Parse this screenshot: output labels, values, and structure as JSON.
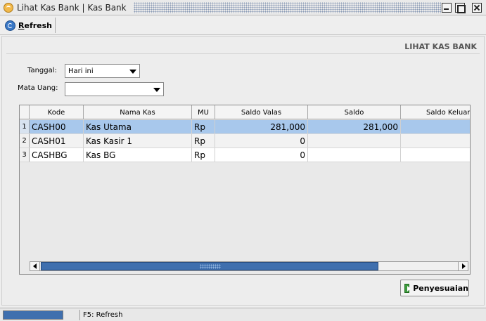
{
  "window": {
    "title": "Lihat Kas Bank | Kas Bank"
  },
  "toolbar": {
    "refresh_label_first": "R",
    "refresh_label_rest": "efresh"
  },
  "page": {
    "title": "LIHAT KAS BANK"
  },
  "form": {
    "tanggal_label": "Tanggal:",
    "tanggal_value": "Hari ini",
    "mata_uang_label": "Mata Uang:",
    "mata_uang_value": ""
  },
  "table": {
    "columns": [
      "Kode",
      "Nama Kas",
      "MU",
      "Saldo Valas",
      "Saldo",
      "Saldo Keluar"
    ],
    "rows": [
      {
        "num": "1",
        "kode": "CASH00",
        "nama": "Kas Utama",
        "mu": "Rp",
        "saldo_valas": "281,000",
        "saldo": "281,000",
        "saldo_keluar": ""
      },
      {
        "num": "2",
        "kode": "CASH01",
        "nama": "Kas Kasir 1",
        "mu": "Rp",
        "saldo_valas": "0",
        "saldo": "",
        "saldo_keluar": ""
      },
      {
        "num": "3",
        "kode": "CASHBG",
        "nama": "Kas BG",
        "mu": "Rp",
        "saldo_valas": "0",
        "saldo": "",
        "saldo_keluar": ""
      }
    ]
  },
  "actions": {
    "penyesuaian_label": "Penyesuaian"
  },
  "statusbar": {
    "hint": "F5: Refresh"
  },
  "colors": {
    "selection": "#a8c8ec",
    "scroll_thumb": "#3f6fae"
  }
}
